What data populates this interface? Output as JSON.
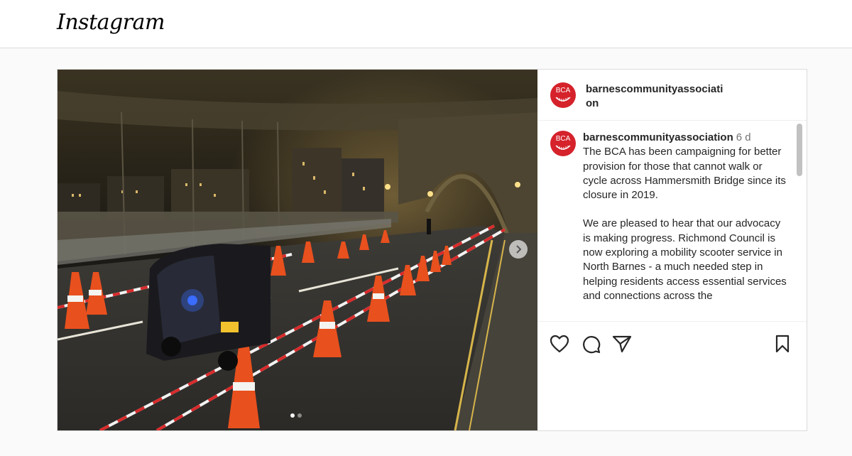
{
  "app": {
    "logo_text": "Instagram"
  },
  "post": {
    "username": "barnescommunityassociation",
    "avatar_text": "BCA",
    "caption": {
      "username": "barnescommunityassociation",
      "time": "6 d",
      "paragraph_1": "The BCA has been campaigning for better provision for those that cannot walk or cycle across Hammersmith Bridge since its closure in 2019.",
      "paragraph_2": "We are pleased to hear that our advocacy is making progress. Richmond Council is now exploring a mobility scooter service in North Barnes - a much needed step in helping residents access essential services and connections across the"
    },
    "carousel": {
      "slides": 2,
      "current_slide": 1
    },
    "actions": {
      "like_icon": "heart-icon",
      "comment_icon": "comment-icon",
      "share_icon": "paper-plane-icon",
      "save_icon": "bookmark-icon"
    },
    "colors": {
      "brand_red": "#d5222b",
      "cone_orange": "#e8501e"
    }
  }
}
